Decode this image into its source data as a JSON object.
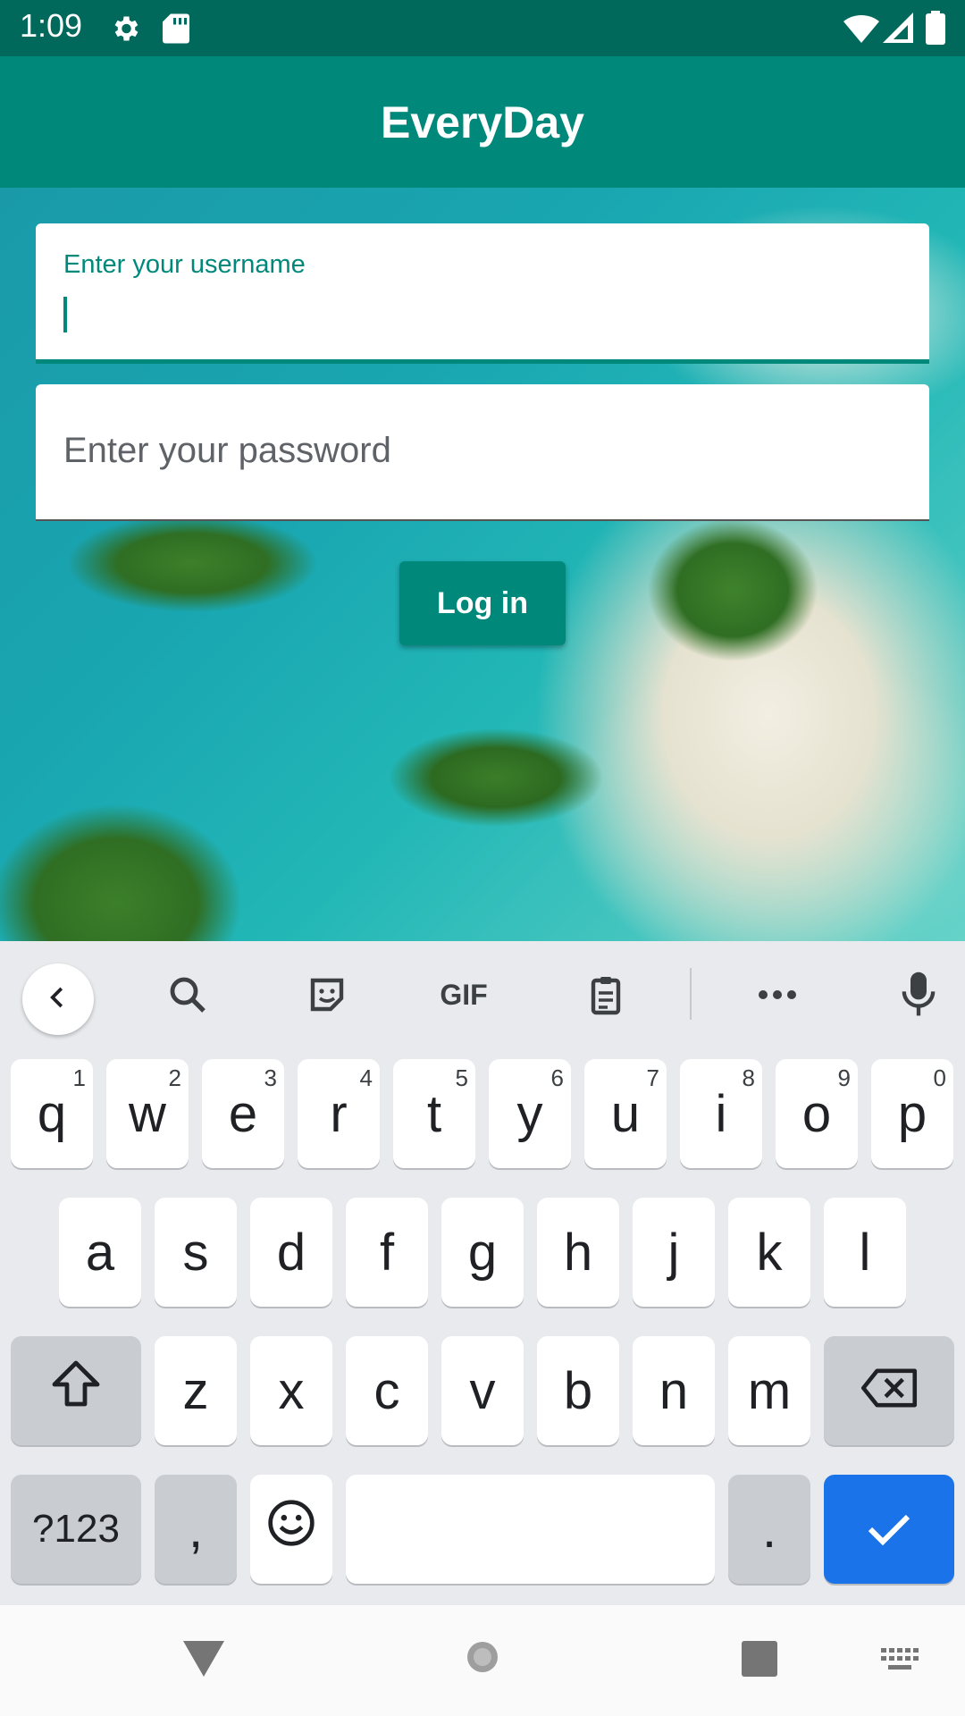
{
  "status_bar": {
    "time": "1:09",
    "icons": [
      "settings-gear-icon",
      "sd-card-icon",
      "wifi-icon",
      "signal-icon",
      "battery-icon"
    ]
  },
  "app_bar": {
    "title": "EveryDay"
  },
  "login_form": {
    "username_label": "Enter your username",
    "username_value": "",
    "password_placeholder": "Enter your password",
    "login_button": "Log in"
  },
  "keyboard": {
    "toolbar": [
      "back-chevron-icon",
      "search-icon",
      "sticker-icon",
      "GIF",
      "clipboard-icon",
      "more-icon",
      "mic-icon"
    ],
    "row1": [
      {
        "label": "q",
        "hint": "1"
      },
      {
        "label": "w",
        "hint": "2"
      },
      {
        "label": "e",
        "hint": "3"
      },
      {
        "label": "r",
        "hint": "4"
      },
      {
        "label": "t",
        "hint": "5"
      },
      {
        "label": "y",
        "hint": "6"
      },
      {
        "label": "u",
        "hint": "7"
      },
      {
        "label": "i",
        "hint": "8"
      },
      {
        "label": "o",
        "hint": "9"
      },
      {
        "label": "p",
        "hint": "0"
      }
    ],
    "row2": [
      "a",
      "s",
      "d",
      "f",
      "g",
      "h",
      "j",
      "k",
      "l"
    ],
    "row3": [
      "z",
      "x",
      "c",
      "v",
      "b",
      "n",
      "m"
    ],
    "symbols_label": "?123",
    "comma_label": ",",
    "period_label": "."
  },
  "nav_bar": {
    "items": [
      "back-triangle-icon",
      "home-icon",
      "recents-square-icon",
      "keyboard-switch-icon"
    ]
  },
  "colors": {
    "primary": "#00897b",
    "primary_dark": "#00695c",
    "keyboard_action": "#1a73e8"
  }
}
